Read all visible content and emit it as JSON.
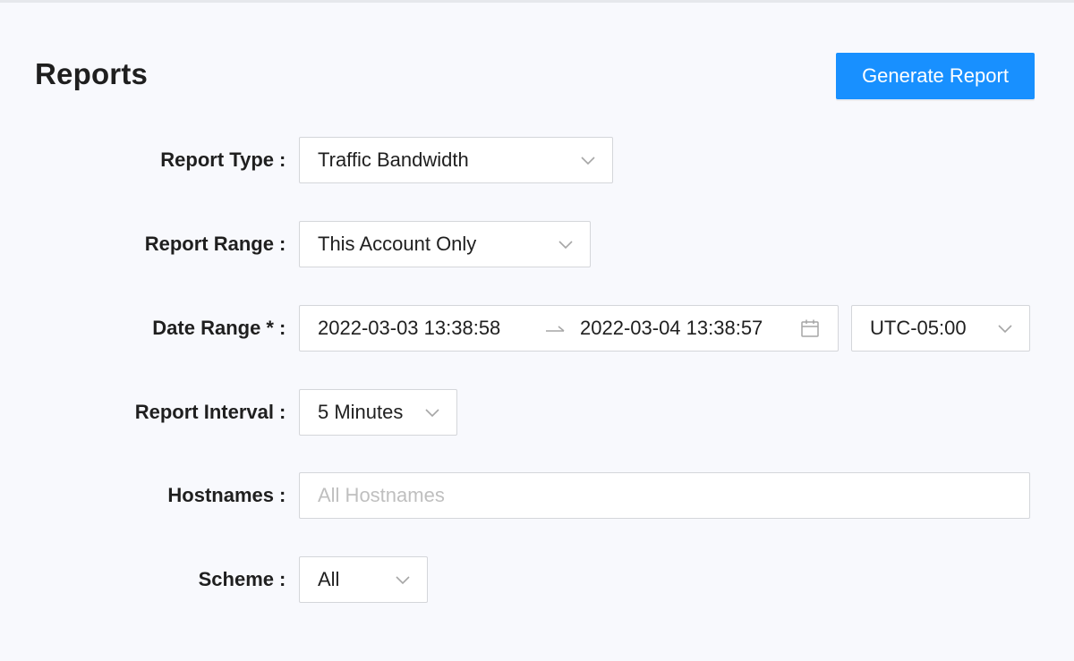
{
  "page": {
    "title": "Reports",
    "generate_button": "Generate Report"
  },
  "form": {
    "report_type": {
      "label": "Report Type",
      "value": "Traffic Bandwidth",
      "icon": "chevron-down-icon"
    },
    "report_range": {
      "label": "Report Range",
      "value": "This Account Only",
      "icon": "chevron-down-icon"
    },
    "date_range": {
      "label": "Date Range *",
      "start": "2022-03-03 13:38:58",
      "end": "2022-03-04 13:38:57",
      "separator_icon": "arrow-right-icon",
      "calendar_icon": "calendar-icon",
      "timezone": "UTC-05:00"
    },
    "report_interval": {
      "label": "Report Interval",
      "value": "5 Minutes",
      "icon": "chevron-down-icon"
    },
    "hostnames": {
      "label": "Hostnames",
      "value": "",
      "placeholder": "All Hostnames"
    },
    "scheme": {
      "label": "Scheme",
      "value": "All",
      "icon": "chevron-down-icon"
    },
    "colon": ":"
  },
  "colors": {
    "primary": "#1890ff",
    "border": "#d4d6da",
    "background": "#f8f9fd",
    "placeholder": "#bfbfbf"
  }
}
